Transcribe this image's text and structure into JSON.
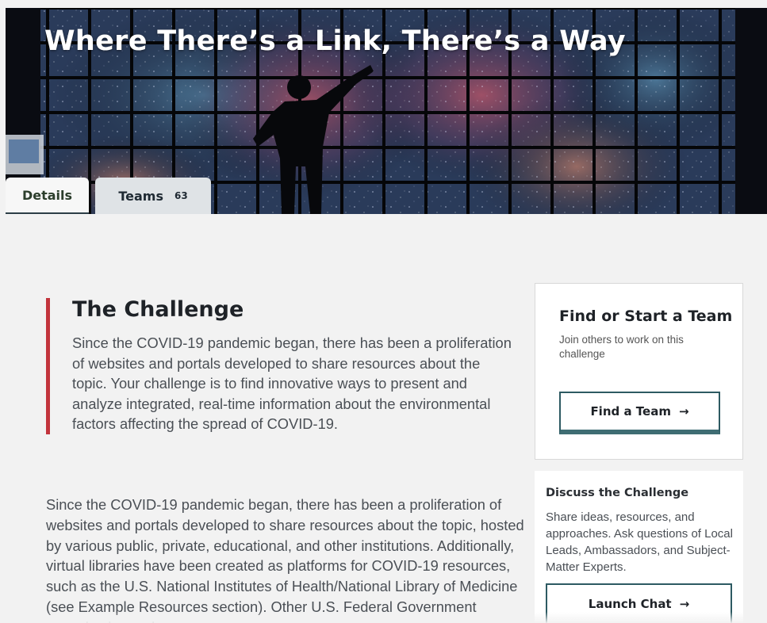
{
  "hero": {
    "title": "Where There’s a Link, There’s a Way"
  },
  "tabs": [
    {
      "label": "Details"
    },
    {
      "label": "Teams",
      "count": "63"
    }
  ],
  "challenge": {
    "heading": "The Challenge",
    "summary": "Since the COVID-19 pandemic began, there has been a proliferation of websites and portals developed to share resources about the topic. Your challenge is to find innovative ways to present and analyze integrated, real-time information about the environmental factors affecting the spread of COVID-19."
  },
  "body": {
    "paragraph": "Since the COVID-19 pandemic began, there has been a proliferation of websites and portals developed to share resources about the topic, hosted by various public, private, educational, and other institutions. Additionally, virtual libraries have been created as platforms for COVID-19 resources, such as the U.S. National Institutes of Health/National Library of Medicine (see Example Resources section). Other U.S. Federal Government agencies have also"
  },
  "team_panel": {
    "title": "Find or Start a Team",
    "subtitle": "Join others to work on this challenge",
    "button_label": "Find a Team",
    "button_arrow": "→"
  },
  "discuss_panel": {
    "title": "Discuss the Challenge",
    "description": "Share ideas, resources, and approaches. Ask questions of Local Leads, Ambassadors, and Subject-Matter Experts.",
    "button_label": "Launch Chat",
    "button_arrow": "→"
  },
  "colors": {
    "accent_bar": "#c2343c",
    "button_border": "#2d5a62"
  }
}
